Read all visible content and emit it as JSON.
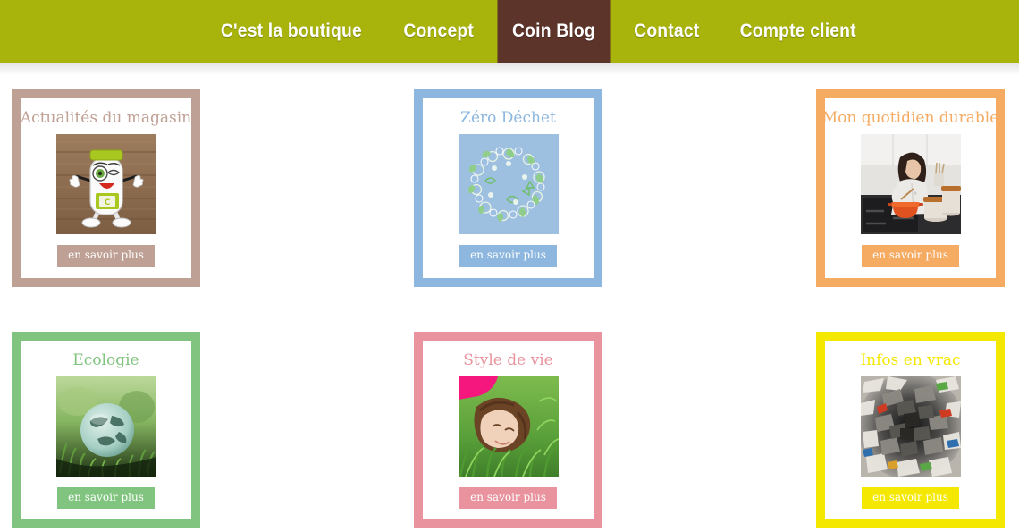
{
  "nav": {
    "background_color": "#a8b40c",
    "active_background_color": "#5c342a",
    "items": [
      {
        "label": "C'est la boutique",
        "active": false
      },
      {
        "label": "Concept",
        "active": false
      },
      {
        "label": "Coin Blog",
        "active": true
      },
      {
        "label": "Contact",
        "active": false
      },
      {
        "label": "Compte client",
        "active": false
      }
    ]
  },
  "cards": [
    {
      "title": "Actualités du magasin",
      "button_label": "en savoir plus",
      "accent_color": "#bfa094",
      "image_name": "mascot-on-wood-image"
    },
    {
      "title": "Zéro Déchet",
      "button_label": "en savoir plus",
      "accent_color": "#8db7de",
      "image_name": "eco-icons-wreath-image"
    },
    {
      "title": "Mon quotidien durable",
      "button_label": "en savoir plus",
      "accent_color": "#f6ab63",
      "image_name": "woman-cooking-kitchen-image"
    },
    {
      "title": "Ecologie",
      "button_label": "en savoir plus",
      "accent_color": "#80c47f",
      "image_name": "earth-globe-in-grass-image"
    },
    {
      "title": "Style de vie",
      "button_label": "en savoir plus",
      "accent_color": "#e8939e",
      "image_name": "woman-lying-in-grass-image"
    },
    {
      "title": "Infos en vrac",
      "button_label": "en savoir plus",
      "accent_color": "#f5e800",
      "image_name": "shredded-paper-recycling-image"
    }
  ]
}
